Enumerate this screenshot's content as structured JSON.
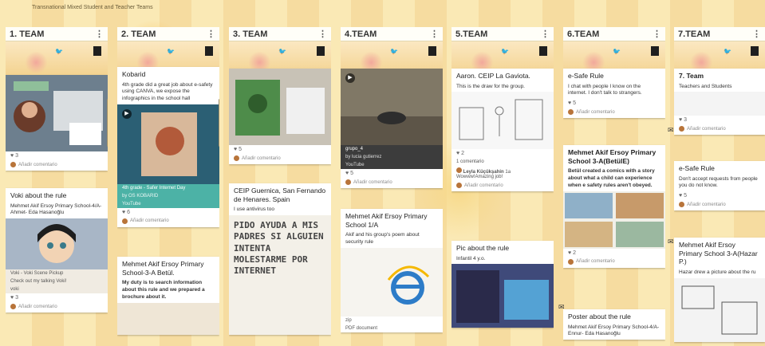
{
  "board": {
    "title": "Transnational Mixed Student and Teacher Teams"
  },
  "icons": {
    "kebab": "vertical-ellipsis-icon",
    "like": "heart-icon",
    "play": "play-icon",
    "twitter": "twitter-icon",
    "envelope": "envelope-icon"
  },
  "comment_label": "Añadir comentario",
  "columns": [
    {
      "title": "1. TEAM"
    },
    {
      "title": "2. TEAM"
    },
    {
      "title": "3. TEAM"
    },
    {
      "title": "4.TEAM"
    },
    {
      "title": "5.TEAM"
    },
    {
      "title": "6.TEAM"
    },
    {
      "title": "7.TEAM"
    }
  ],
  "c1": {
    "card1_likes": "3",
    "card2_title": "Voki about the rule",
    "card2_body": "Mehmet Akif Ersoy Primary School-4/A- Ahmet- Eda Hasanoğlu",
    "card2_caption1": "Voki - Voki Scene Pickup",
    "card2_caption2": "Check out my talking Voki!",
    "card2_caption3": "voki",
    "card2_likes": "3"
  },
  "c2": {
    "card1_title": "Kobarid",
    "card1_body": "4th grade did a great job about e-safety using CANVA, we expose the infographics in the school hall",
    "card1_video_title": "4th grade - Safer Internet Day",
    "card1_video_by": "by OS KOBARID",
    "card1_video_src": "YouTube",
    "card1_likes": "6",
    "card2_title": "Mehmet Akif Ersoy Primary School-3-A Betül.",
    "card2_body": "My duty is to search information about this rule and we prepared a brochure about it."
  },
  "c3": {
    "card1_likes": "5",
    "card2_title": "CEIP Guernica, San Fernando de Henares. Spain",
    "card2_body": "I use antivirus too",
    "drawing_text": "PIDO AYUDA A MIS PADRES SI ALGUIEN INTENTA MOLESTARME POR INTERNET"
  },
  "c4": {
    "card1_caption1": "grupo_4",
    "card1_caption2": "by lucia gutierrez",
    "card1_caption3": "YouTube",
    "card1_likes": "5",
    "card2_title": "Mehmet Akif Ersoy Primary School 1/A",
    "card2_body": "Akif and his group's poem about security rule",
    "card2_caption1": "zip",
    "card2_caption2": "PDF document"
  },
  "c5": {
    "card1_title": "Aaron. CEIP La Gaviota.",
    "card1_body": "This is the draw for the group.",
    "card1_likes": "2",
    "card1_comments": "1 comentario",
    "card1_commenter": "Leyla Küçükşahin",
    "card1_comment_time": "1a",
    "card1_comment_text": "Wowww!Amazing job!",
    "card2_title": "Pic about the rule",
    "card2_body": "Infantil 4 y.o."
  },
  "c6": {
    "card1_title": "e-Safe Rule",
    "card1_body": "I chat with people I know on the internet. I don't talk to strangers.",
    "card1_likes": "5",
    "card2_title": "Mehmet Akif Ersoy Primary School 3-A(BetülE)",
    "card2_body": "Betül created a comics with a story about what a child can experience when e safety rules aren't obeyed.",
    "card2_likes": "2",
    "card3_title": "Poster about the rule",
    "card3_body": "Mehmet Akif Ersoy Primary School-4/A- Ennur- Eda Hasanoğlu"
  },
  "c7": {
    "card1_title": "7. Team",
    "card1_body": "Teachers and Students",
    "card1_likes": "3",
    "card2_title": "e-Safe Rule",
    "card2_body": "Don't accept requests from people you do not know.",
    "card2_likes": "5",
    "card3_title": "Mehmet Akif Ersoy Primary School 3-A(Hazar P.)",
    "card3_body": "Hazar drew a picture about the ru"
  }
}
